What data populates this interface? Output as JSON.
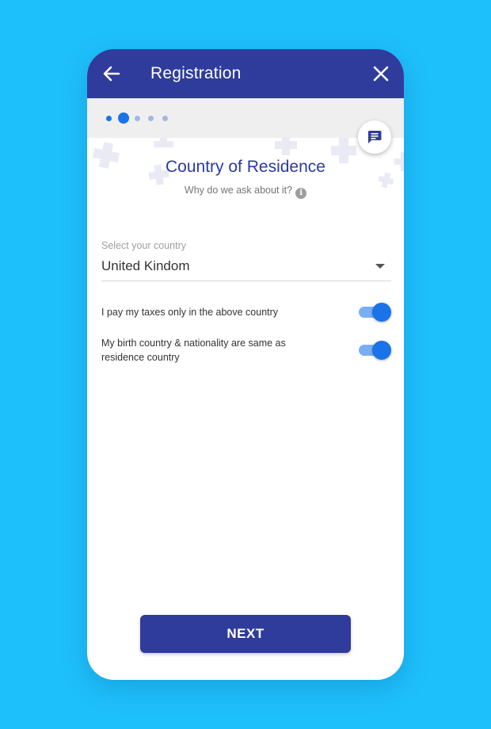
{
  "header": {
    "title": "Registration",
    "back_icon": "arrow-left-icon",
    "close_icon": "close-icon",
    "background": "#2f3c9c"
  },
  "progress": {
    "total_steps": 5,
    "current_step": 2,
    "active_color": "#1a73e8",
    "inactive_color": "#9fb7e6"
  },
  "chat": {
    "icon": "chat-bubble-icon"
  },
  "main": {
    "title": "Country of Residence",
    "why_text": "Why do we ask about it?",
    "info_icon": "info-icon",
    "info_glyph": "i"
  },
  "country_select": {
    "label": "Select your country",
    "value": "United Kindom",
    "icon": "dropdown-arrow-icon"
  },
  "toggles": [
    {
      "label": "I pay my taxes only in the above country",
      "on": true
    },
    {
      "label": "My birth country & nationality are same as residence country",
      "on": true
    }
  ],
  "footer": {
    "next_label": "NEXT",
    "button_color": "#2f3c9c"
  },
  "page_background": "#1ec0fc"
}
